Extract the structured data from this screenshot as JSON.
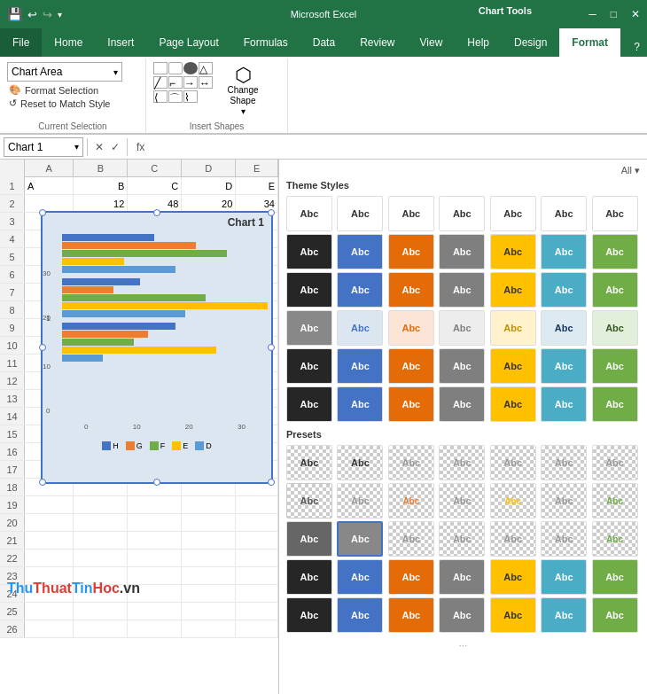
{
  "titlebar": {
    "app_title": "Chart Tools",
    "save_icon": "💾",
    "undo_icon": "↩",
    "redo_icon": "↪"
  },
  "tabs": [
    {
      "label": "File",
      "active": false
    },
    {
      "label": "Home",
      "active": false
    },
    {
      "label": "Insert",
      "active": false
    },
    {
      "label": "Page Layout",
      "active": false
    },
    {
      "label": "Formulas",
      "active": false
    },
    {
      "label": "Data",
      "active": false
    },
    {
      "label": "Review",
      "active": false
    },
    {
      "label": "View",
      "active": false
    },
    {
      "label": "Help",
      "active": false
    },
    {
      "label": "Design",
      "active": false
    },
    {
      "label": "Format",
      "active": true
    }
  ],
  "ribbon": {
    "current_selection": {
      "group_label": "Current Selection",
      "name_box_value": "Chart Area",
      "format_selection": "Format Selection",
      "reset_to_match": "Reset to Match Style"
    },
    "insert_shapes": {
      "group_label": "Insert Shapes",
      "change_shape": "Change\nShape"
    }
  },
  "formula_bar": {
    "name": "Chart 1",
    "fx": "fx"
  },
  "spreadsheet": {
    "columns": [
      "A",
      "B",
      "C",
      "D",
      "E"
    ],
    "rows": [
      {
        "num": "1",
        "cells": [
          "A",
          "B",
          "C",
          "D",
          "E"
        ]
      },
      {
        "num": "2",
        "cells": [
          "",
          "12",
          "48",
          "20",
          "34"
        ]
      },
      {
        "num": "3",
        "cells": [
          "",
          "",
          "",
          "",
          ""
        ]
      },
      {
        "num": "4",
        "cells": [
          "",
          "",
          "",
          "",
          ""
        ]
      },
      {
        "num": "5",
        "cells": [
          "",
          "",
          "",
          "",
          ""
        ]
      },
      {
        "num": "6",
        "cells": [
          "",
          "",
          "",
          "",
          ""
        ]
      },
      {
        "num": "7",
        "cells": [
          "",
          "",
          "",
          "",
          ""
        ]
      },
      {
        "num": "8",
        "cells": [
          "",
          "",
          "",
          "",
          ""
        ]
      },
      {
        "num": "9",
        "cells": [
          "",
          "",
          "",
          "",
          ""
        ]
      },
      {
        "num": "10",
        "cells": [
          "",
          "",
          "",
          "",
          ""
        ]
      },
      {
        "num": "11",
        "cells": [
          "",
          "",
          "",
          "",
          ""
        ]
      },
      {
        "num": "12",
        "cells": [
          "",
          "",
          "",
          "",
          ""
        ]
      },
      {
        "num": "13",
        "cells": [
          "",
          "",
          "",
          "",
          ""
        ]
      },
      {
        "num": "14",
        "cells": [
          "",
          "",
          "",
          "",
          ""
        ]
      },
      {
        "num": "15",
        "cells": [
          "",
          "",
          "",
          "",
          ""
        ]
      },
      {
        "num": "16",
        "cells": [
          "",
          "",
          "",
          "",
          ""
        ]
      },
      {
        "num": "17",
        "cells": [
          "",
          "",
          "",
          "",
          ""
        ]
      },
      {
        "num": "18",
        "cells": [
          "",
          "",
          "",
          "",
          ""
        ]
      },
      {
        "num": "19",
        "cells": [
          "",
          "",
          "",
          "",
          ""
        ]
      },
      {
        "num": "20",
        "cells": [
          "",
          "",
          "",
          "",
          ""
        ]
      },
      {
        "num": "21",
        "cells": [
          "",
          "",
          "",
          "",
          ""
        ]
      },
      {
        "num": "22",
        "cells": [
          "",
          "",
          "",
          "",
          ""
        ]
      },
      {
        "num": "23",
        "cells": [
          "",
          "",
          "",
          "",
          ""
        ]
      },
      {
        "num": "24",
        "cells": [
          "",
          "",
          "",
          "",
          ""
        ]
      },
      {
        "num": "25",
        "cells": [
          "",
          "",
          "",
          "",
          ""
        ]
      },
      {
        "num": "26",
        "cells": [
          "",
          "",
          "",
          "",
          ""
        ]
      }
    ]
  },
  "chart": {
    "title": "Chart 1",
    "legend": [
      {
        "label": "H",
        "color": "#4472c4"
      },
      {
        "label": "G",
        "color": "#ed7d31"
      },
      {
        "label": "F",
        "color": "#70ad47"
      },
      {
        "label": "E",
        "color": "#ffc000"
      },
      {
        "label": "D",
        "color": "#5b9bd5"
      }
    ]
  },
  "right_panel": {
    "all_label": "All ▾",
    "theme_styles": {
      "title": "Theme Styles",
      "rows": [
        [
          {
            "text": "Abc",
            "style": "abc-white"
          },
          {
            "text": "Abc",
            "style": "abc-white"
          },
          {
            "text": "Abc",
            "style": "abc-white"
          },
          {
            "text": "Abc",
            "style": "abc-white"
          },
          {
            "text": "Abc",
            "style": "abc-white"
          },
          {
            "text": "Abc",
            "style": "abc-white"
          },
          {
            "text": "Abc",
            "style": "abc-white"
          }
        ],
        [
          {
            "text": "Abc",
            "style": "abc-black"
          },
          {
            "text": "Abc",
            "style": "abc-blue"
          },
          {
            "text": "Abc",
            "style": "abc-orange"
          },
          {
            "text": "Abc",
            "style": "abc-gray"
          },
          {
            "text": "Abc",
            "style": "abc-yellow"
          },
          {
            "text": "Abc",
            "style": "abc-lblue"
          },
          {
            "text": "Abc",
            "style": "abc-green"
          }
        ],
        [
          {
            "text": "Abc",
            "style": "abc-black"
          },
          {
            "text": "Abc",
            "style": "abc-blue"
          },
          {
            "text": "Abc",
            "style": "abc-orange"
          },
          {
            "text": "Abc",
            "style": "abc-gray"
          },
          {
            "text": "Abc",
            "style": "abc-yellow"
          },
          {
            "text": "Abc",
            "style": "abc-lblue"
          },
          {
            "text": "Abc",
            "style": "abc-green"
          }
        ],
        [
          {
            "text": "Abc",
            "style": "abc-gray"
          },
          {
            "text": "Abc",
            "style": "abc-lightblue"
          },
          {
            "text": "Abc",
            "style": "abc-lightorange"
          },
          {
            "text": "Abc",
            "style": "abc-lightgray"
          },
          {
            "text": "Abc",
            "style": "abc-lightyellow"
          },
          {
            "text": "Abc",
            "style": "abc-lightlblue"
          },
          {
            "text": "Abc",
            "style": "abc-lightgreen"
          }
        ],
        [
          {
            "text": "Abc",
            "style": "abc-black"
          },
          {
            "text": "Abc",
            "style": "abc-blue"
          },
          {
            "text": "Abc",
            "style": "abc-orange"
          },
          {
            "text": "Abc",
            "style": "abc-gray"
          },
          {
            "text": "Abc",
            "style": "abc-yellow"
          },
          {
            "text": "Abc",
            "style": "abc-lblue"
          },
          {
            "text": "Abc",
            "style": "abc-green"
          }
        ],
        [
          {
            "text": "Abc",
            "style": "abc-black"
          },
          {
            "text": "Abc",
            "style": "abc-blue"
          },
          {
            "text": "Abc",
            "style": "abc-orange"
          },
          {
            "text": "Abc",
            "style": "abc-gray"
          },
          {
            "text": "Abc",
            "style": "abc-yellow"
          },
          {
            "text": "Abc",
            "style": "abc-lblue"
          },
          {
            "text": "Abc",
            "style": "abc-green"
          }
        ]
      ]
    },
    "presets": {
      "title": "Presets",
      "rows": [
        [
          {
            "text": "Abc",
            "style": "abc-white",
            "preset": true
          },
          {
            "text": "Abc",
            "style": "abc-white",
            "preset": true
          },
          {
            "text": "Abc",
            "style": "abc-white",
            "preset": true
          },
          {
            "text": "Abc",
            "style": "abc-white",
            "preset": true
          },
          {
            "text": "Abc",
            "style": "abc-white",
            "preset": true
          },
          {
            "text": "Abc",
            "style": "abc-white",
            "preset": true
          },
          {
            "text": "Abc",
            "style": "abc-white",
            "preset": true
          }
        ],
        [
          {
            "text": "Abc",
            "style": "abc-white",
            "preset": true
          },
          {
            "text": "Abc",
            "style": "abc-white",
            "preset": true
          },
          {
            "text": "Abc",
            "style": "abc-white",
            "preset": true
          },
          {
            "text": "Abc",
            "style": "abc-white",
            "preset": true
          },
          {
            "text": "Abc",
            "style": "abc-white",
            "preset": true
          },
          {
            "text": "Abc",
            "style": "abc-white",
            "preset": true
          },
          {
            "text": "Abc",
            "style": "abc-white",
            "preset": true
          }
        ],
        [
          {
            "text": "Abc",
            "style": "abc-gray",
            "preset": true,
            "selected": true
          },
          {
            "text": "Abc",
            "style": "abc-gray",
            "preset": true,
            "selected": true
          },
          {
            "text": "Abc",
            "style": "abc-white",
            "preset": true
          },
          {
            "text": "Abc",
            "style": "abc-white",
            "preset": true
          },
          {
            "text": "Abc",
            "style": "abc-white",
            "preset": true
          },
          {
            "text": "Abc",
            "style": "abc-white",
            "preset": true
          },
          {
            "text": "Abc",
            "style": "abc-white",
            "preset": true
          }
        ],
        [
          {
            "text": "Abc",
            "style": "abc-black",
            "preset": true
          },
          {
            "text": "Abc",
            "style": "abc-blue",
            "preset": true
          },
          {
            "text": "Abc",
            "style": "abc-orange",
            "preset": true
          },
          {
            "text": "Abc",
            "style": "abc-gray",
            "preset": true
          },
          {
            "text": "Abc",
            "style": "abc-yellow",
            "preset": true
          },
          {
            "text": "Abc",
            "style": "abc-lblue",
            "preset": true
          },
          {
            "text": "Abc",
            "style": "abc-green",
            "preset": true
          }
        ],
        [
          {
            "text": "Abc",
            "style": "abc-black",
            "preset": true
          },
          {
            "text": "Abc",
            "style": "abc-blue",
            "preset": true
          },
          {
            "text": "Abc",
            "style": "abc-orange",
            "preset": true
          },
          {
            "text": "Abc",
            "style": "abc-gray",
            "preset": true
          },
          {
            "text": "Abc",
            "style": "abc-yellow",
            "preset": true
          },
          {
            "text": "Abc",
            "style": "abc-lblue",
            "preset": true
          },
          {
            "text": "Abc",
            "style": "abc-green",
            "preset": true
          }
        ]
      ]
    }
  },
  "watermark": {
    "thu": "Thu",
    "thuat": "Thuat",
    "tin": "Tin",
    "hoc": "Hoc",
    "vn": ".vn"
  }
}
